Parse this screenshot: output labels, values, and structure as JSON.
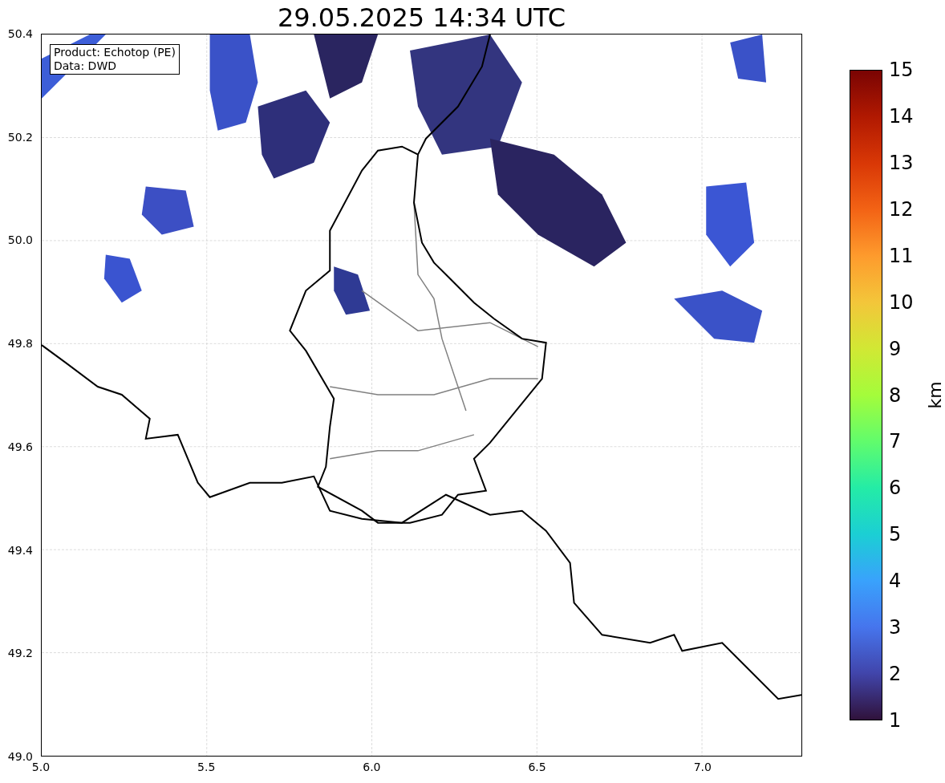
{
  "title": "29.05.2025 14:34 UTC",
  "legend": [
    "Product: Echotop (PE)",
    "Data: DWD"
  ],
  "map": {
    "xticks": [
      "5.0",
      "5.5",
      "6.0",
      "6.5",
      "7.0"
    ],
    "yticks": [
      "50.4",
      "50.2",
      "50.0",
      "49.8",
      "49.6",
      "49.4",
      "49.2",
      "49.0"
    ]
  },
  "colorbar": {
    "label": "km",
    "ticks": [
      "15",
      "14",
      "13",
      "12",
      "11",
      "10",
      "9",
      "8",
      "7",
      "6",
      "5",
      "4",
      "3",
      "2",
      "1"
    ]
  }
}
